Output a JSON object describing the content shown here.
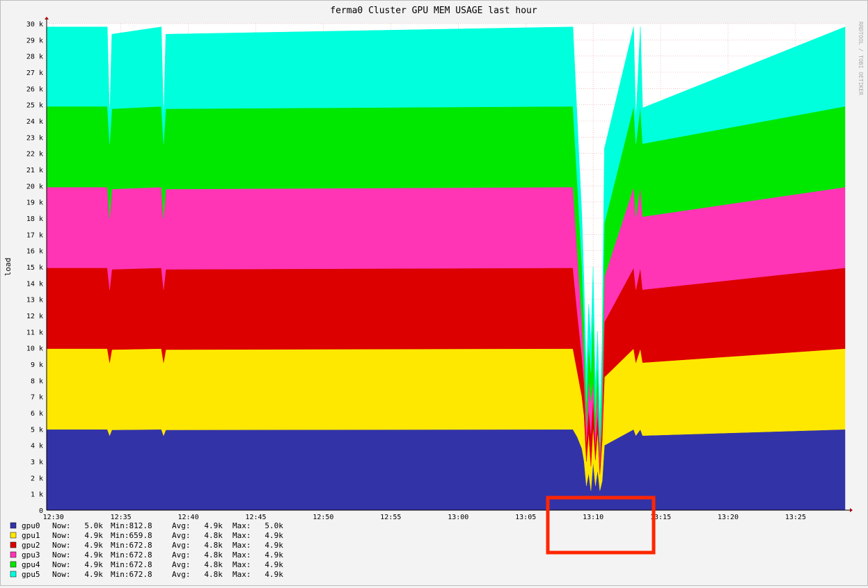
{
  "chart_data": {
    "type": "area",
    "stacked": true,
    "title": "ferma0 Cluster GPU MEM USAGE last hour",
    "ylabel": "load",
    "watermark": "RRDTOOL / TOBI OETIKER",
    "ylim": [
      0,
      30000
    ],
    "yticks": [
      "0",
      "1 k",
      "2 k",
      "3 k",
      "4 k",
      "5 k",
      "6 k",
      "7 k",
      "8 k",
      "9 k",
      "10 k",
      "11 k",
      "12 k",
      "13 k",
      "14 k",
      "15 k",
      "16 k",
      "17 k",
      "18 k",
      "19 k",
      "20 k",
      "21 k",
      "22 k",
      "23 k",
      "24 k",
      "25 k",
      "26 k",
      "27 k",
      "28 k",
      "29 k",
      "30 k"
    ],
    "xticks": [
      "12:30",
      "12:35",
      "12:40",
      "12:45",
      "12:50",
      "12:55",
      "13:00",
      "13:05",
      "13:10",
      "13:15",
      "13:20",
      "13:25"
    ],
    "grid": true,
    "legend_position": "bottom-left",
    "highlight_box_color": "#ff2600",
    "x": [
      "12:29:30",
      "12:34:00",
      "12:34:10",
      "12:34:20",
      "12:38:00",
      "12:38:10",
      "12:38:20",
      "13:08:30",
      "13:08:50",
      "13:09:10",
      "13:09:20",
      "13:09:30",
      "13:09:40",
      "13:09:50",
      "13:10:00",
      "13:10:10",
      "13:10:20",
      "13:10:30",
      "13:10:40",
      "13:10:50",
      "13:13:00",
      "13:13:10",
      "13:13:30",
      "13:13:40",
      "13:28:40"
    ],
    "series": [
      {
        "name": "gpu0",
        "color": "#3333a8",
        "values": [
          4980,
          4980,
          4600,
          4950,
          4980,
          4600,
          4950,
          4980,
          4500,
          3800,
          3000,
          1500,
          2300,
          1200,
          3000,
          1500,
          2500,
          1200,
          1800,
          4000,
          4980,
          4600,
          4980,
          4600,
          4980
        ]
      },
      {
        "name": "gpu1",
        "color": "#ffe800",
        "values": [
          4980,
          4980,
          4500,
          4950,
          4980,
          4500,
          4950,
          4980,
          4000,
          3200,
          2800,
          1500,
          2500,
          1500,
          2200,
          1600,
          2400,
          1000,
          2500,
          4200,
          4980,
          4500,
          4980,
          4500,
          4980
        ]
      },
      {
        "name": "gpu2",
        "color": "#dd0000",
        "values": [
          4980,
          4980,
          4500,
          4950,
          4980,
          4500,
          4950,
          4980,
          3600,
          2500,
          2000,
          1200,
          1500,
          2000,
          1800,
          900,
          1200,
          600,
          1100,
          3400,
          4980,
          4500,
          4980,
          4500,
          4980
        ]
      },
      {
        "name": "gpu3",
        "color": "#ff35b5",
        "values": [
          4980,
          4980,
          4400,
          4950,
          4980,
          4400,
          4950,
          4980,
          3700,
          2200,
          1400,
          1000,
          1800,
          2000,
          1000,
          800,
          1600,
          600,
          1500,
          2800,
          4980,
          4500,
          4980,
          4500,
          4980
        ]
      },
      {
        "name": "gpu4",
        "color": "#00e800",
        "values": [
          4980,
          4980,
          4600,
          4950,
          4980,
          4600,
          4950,
          4980,
          4300,
          3300,
          2200,
          1500,
          2200,
          1800,
          4200,
          1200,
          1500,
          800,
          1600,
          3300,
          4980,
          4500,
          4980,
          4500,
          4980
        ]
      },
      {
        "name": "gpu5",
        "color": "#00ffdd",
        "values": [
          4900,
          4900,
          1500,
          4600,
          4900,
          1500,
          4600,
          4900,
          3800,
          3100,
          2300,
          1600,
          2400,
          1800,
          2800,
          1500,
          1800,
          1300,
          2200,
          4600,
          4900,
          1500,
          4900,
          2200,
          4900
        ]
      }
    ],
    "legend": [
      {
        "name": "gpu0",
        "now": "Now:   5.0k",
        "min": "Min:812.8",
        "avg": "Avg:   4.9k",
        "max": "Max:   5.0k",
        "color": "#3333a8"
      },
      {
        "name": "gpu1",
        "now": "Now:   4.9k",
        "min": "Min:659.8",
        "avg": "Avg:   4.8k",
        "max": "Max:   4.9k",
        "color": "#ffe800"
      },
      {
        "name": "gpu2",
        "now": "Now:   4.9k",
        "min": "Min:672.8",
        "avg": "Avg:   4.8k",
        "max": "Max:   4.9k",
        "color": "#dd0000"
      },
      {
        "name": "gpu3",
        "now": "Now:   4.9k",
        "min": "Min:672.8",
        "avg": "Avg:   4.8k",
        "max": "Max:   4.9k",
        "color": "#ff35b5"
      },
      {
        "name": "gpu4",
        "now": "Now:   4.9k",
        "min": "Min:672.8",
        "avg": "Avg:   4.8k",
        "max": "Max:   4.9k",
        "color": "#00e800"
      },
      {
        "name": "gpu5",
        "now": "Now:   4.9k",
        "min": "Min:672.8",
        "avg": "Avg:   4.8k",
        "max": "Max:   4.9k",
        "color": "#00ffdd"
      }
    ]
  }
}
